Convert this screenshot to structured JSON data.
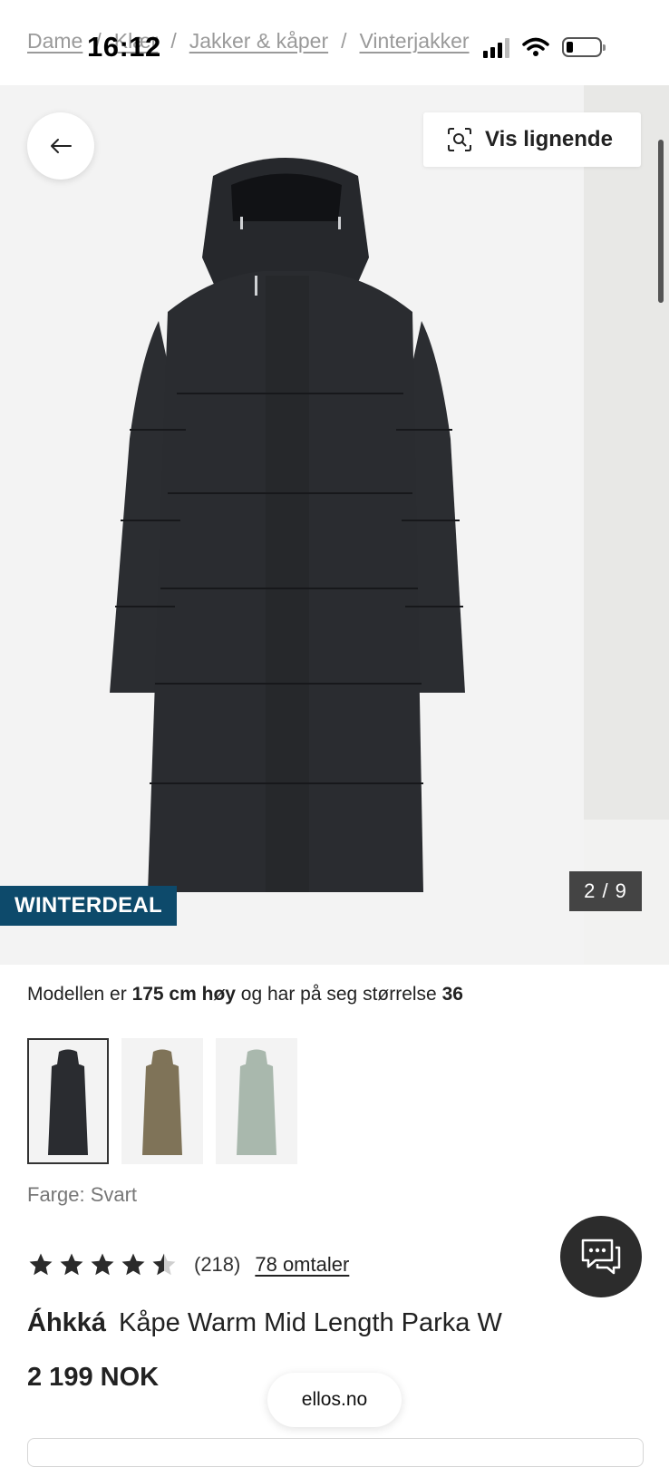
{
  "status_bar": {
    "time": "16:12"
  },
  "breadcrumb": [
    "Dame",
    "Klær",
    "Jakker & kåper",
    "Vinterjakker"
  ],
  "gallery": {
    "similar_label": "Vis lignende",
    "badge": "WINTERDEAL",
    "counter": "2 / 9"
  },
  "model_info": {
    "prefix": "Modellen er ",
    "height": "175 cm høy",
    "middle": " og har på seg størrelse ",
    "size": "36"
  },
  "color": {
    "label": "Farge: Svart",
    "swatch_colors": [
      "#2a2c30",
      "#7f7358",
      "#a9b8ad"
    ]
  },
  "rating": {
    "stars": 4.5,
    "count": "(218)",
    "reviews_link": "78 omtaler"
  },
  "product": {
    "brand": "Áhkká",
    "name": "Kåpe Warm Mid Length Parka W",
    "price": "2 199 NOK"
  },
  "browser": {
    "domain": "ellos.no"
  }
}
